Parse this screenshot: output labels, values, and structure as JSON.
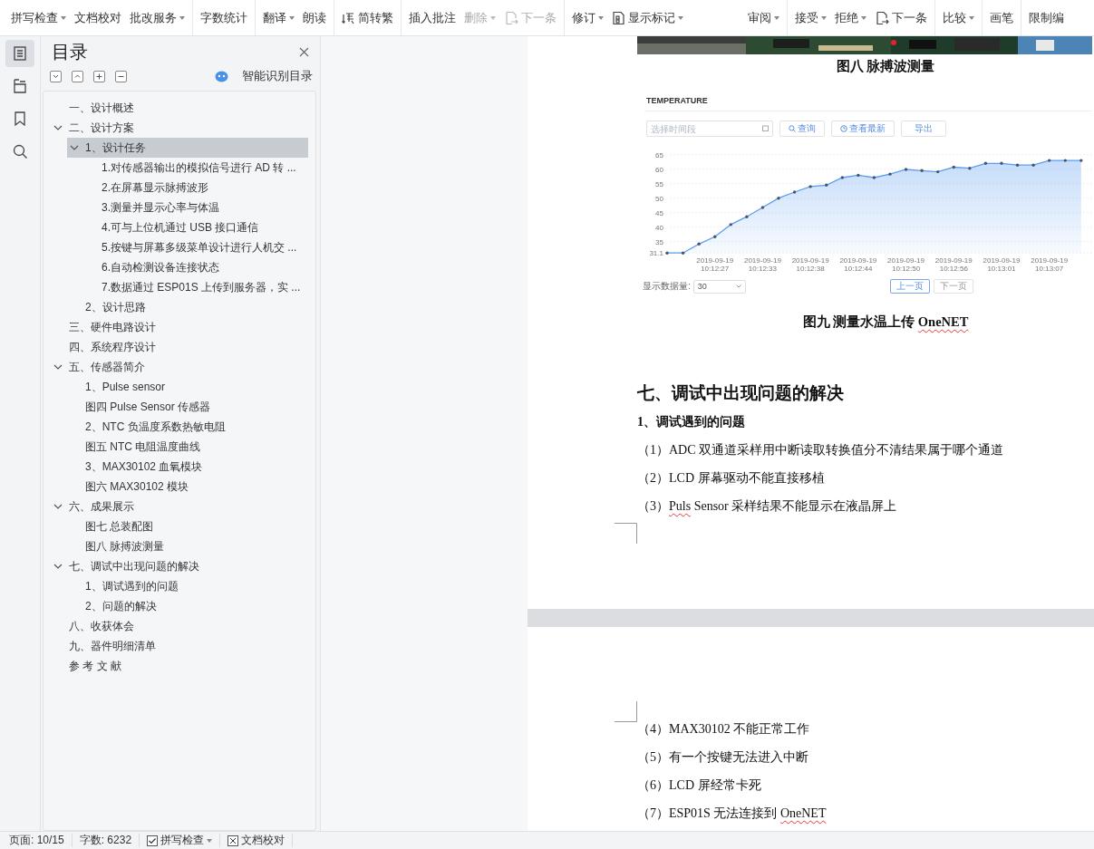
{
  "toolbar": {
    "groups": [
      {
        "items": [
          {
            "label": "拼写检查",
            "kind": "text",
            "caret": true,
            "disabled": false
          },
          {
            "label": "文档校对",
            "kind": "text",
            "caret": false,
            "disabled": false
          },
          {
            "label": "批改服务",
            "kind": "text",
            "caret": true,
            "disabled": false
          }
        ]
      },
      {
        "items": [
          {
            "label": "字数统计",
            "kind": "text",
            "caret": false,
            "disabled": false
          }
        ]
      },
      {
        "items": [
          {
            "label": "翻译",
            "kind": "text",
            "caret": true,
            "disabled": false
          },
          {
            "label": "朗读",
            "kind": "text",
            "caret": false,
            "disabled": false
          }
        ]
      },
      {
        "items": [
          {
            "label": "简转繁",
            "kind": "convert",
            "caret": false,
            "disabled": false
          }
        ]
      },
      {
        "items": [
          {
            "label": "插入批注",
            "kind": "text",
            "caret": false,
            "disabled": false
          },
          {
            "label": "删除",
            "kind": "text",
            "caret": true,
            "disabled": true
          },
          {
            "label": "下一条",
            "kind": "next",
            "caret": false,
            "disabled": true
          }
        ]
      },
      {
        "items": [
          {
            "label": "修订",
            "kind": "text",
            "caret": true,
            "disabled": false
          },
          {
            "label": "显示标记",
            "kind": "markup",
            "caret": true,
            "disabled": false
          },
          {
            "label": "审阅",
            "kind": "text",
            "caret": true,
            "disabled": false
          }
        ]
      },
      {
        "items": [
          {
            "label": "接受",
            "kind": "text",
            "caret": true,
            "disabled": false
          },
          {
            "label": "拒绝",
            "kind": "text",
            "caret": true,
            "disabled": false
          },
          {
            "label": "下一条",
            "kind": "next",
            "caret": false,
            "disabled": false
          }
        ]
      },
      {
        "items": [
          {
            "label": "比较",
            "kind": "text",
            "caret": true,
            "disabled": false
          }
        ]
      },
      {
        "items": [
          {
            "label": "画笔",
            "kind": "text",
            "caret": false,
            "disabled": false
          }
        ]
      },
      {
        "items": [
          {
            "label": "限制编",
            "kind": "text",
            "caret": false,
            "disabled": false
          }
        ]
      }
    ]
  },
  "rail": [
    {
      "kind": "outline",
      "selected": true
    },
    {
      "kind": "navigation",
      "selected": false
    },
    {
      "kind": "bookmark",
      "selected": false
    },
    {
      "kind": "search",
      "selected": false
    }
  ],
  "outline": {
    "title": "目录",
    "smart_detect": "智能识别目录",
    "tree": [
      {
        "label": "一、设计概述",
        "selected": false
      },
      {
        "label": "二、设计方案",
        "selected": false,
        "expanded": true,
        "children": [
          {
            "label": "1、设计任务",
            "selected": true,
            "expanded": true,
            "children": [
              {
                "label": "1.对传感器输出的模拟信号进行 AD 转 ...",
                "selected": false
              },
              {
                "label": "2.在屏幕显示脉搏波形",
                "selected": false
              },
              {
                "label": "3.测量并显示心率与体温",
                "selected": false
              },
              {
                "label": "4.可与上位机通过 USB 接口通信",
                "selected": false
              },
              {
                "label": "5.按键与屏幕多级菜单设计进行人机交 ...",
                "selected": false
              },
              {
                "label": "6.自动检测设备连接状态",
                "selected": false
              },
              {
                "label": "7.数据通过 ESP01S 上传到服务器，实 ...",
                "selected": false
              }
            ]
          },
          {
            "label": "2、设计思路",
            "selected": false
          }
        ]
      },
      {
        "label": "三、硬件电路设计",
        "selected": false
      },
      {
        "label": "四、系统程序设计",
        "selected": false
      },
      {
        "label": "五、传感器简介",
        "selected": false,
        "expanded": true,
        "children": [
          {
            "label": "1、Pulse sensor",
            "selected": false
          },
          {
            "label": "图四  Pulse Sensor 传感器",
            "selected": false
          },
          {
            "label": "2、NTC 负温度系数热敏电阻",
            "selected": false
          },
          {
            "label": "图五  NTC 电阻温度曲线",
            "selected": false
          },
          {
            "label": "3、MAX30102 血氧模块",
            "selected": false
          },
          {
            "label": "图六  MAX30102 模块",
            "selected": false
          }
        ]
      },
      {
        "label": "六、成果展示",
        "selected": false,
        "expanded": true,
        "children": [
          {
            "label": "图七  总装配图",
            "selected": false
          },
          {
            "label": "图八  脉搏波测量",
            "selected": false
          }
        ]
      },
      {
        "label": "七、调试中出现问题的解决",
        "selected": false,
        "expanded": true,
        "children": [
          {
            "label": "1、调试遇到的问题",
            "selected": false
          },
          {
            "label": "2、问题的解决",
            "selected": false
          }
        ]
      },
      {
        "label": "八、收获体会",
        "selected": false
      },
      {
        "label": "九、器件明细清单",
        "selected": false
      },
      {
        "label": "参 考 文 献",
        "selected": false
      }
    ]
  },
  "document": {
    "pages": [
      {
        "blocks": [
          {
            "kind": "picture"
          },
          {
            "kind": "caption",
            "parts": [
              {
                "text": "图八  脉搏波测量",
                "flagged": false
              }
            ]
          },
          {
            "kind": "figure",
            "header": "TEMPERATURE",
            "date_field": {
              "placeholder": "选择时间段"
            },
            "buttons": [
              {
                "kind": "search",
                "label": "查询"
              },
              {
                "kind": "refresh",
                "label": "查看最新"
              },
              {
                "kind": "export",
                "label": "导出"
              }
            ],
            "chart_data": {
              "type": "area",
              "categories": [
                null,
                null,
                null,
                "2019-09-19 10:12:27",
                null,
                null,
                "2019-09-19 10:12:33",
                null,
                null,
                "2019-09-19 10:12:38",
                null,
                null,
                "2019-09-19 10:12:44",
                null,
                null,
                "2019-09-19 10:12:50",
                null,
                null,
                "2019-09-19 10:12:56",
                null,
                null,
                "2019-09-19 10:13:01",
                null,
                null,
                "2019-09-19 10:13:07",
                null,
                null
              ],
              "series": [
                {
                  "color": "#5b9cf0",
                  "values": [
                    31.1,
                    31.1,
                    34.2,
                    36.7,
                    40.9,
                    43.6,
                    46.8,
                    50,
                    52.1,
                    54,
                    54.5,
                    57.1,
                    57.9,
                    57.1,
                    58.3,
                    59.9,
                    59.5,
                    59.1,
                    60.7,
                    60.3,
                    62,
                    62,
                    61.4,
                    61.4,
                    63,
                    63,
                    63
                  ]
                }
              ],
              "ylim": [
                31.1,
                65
              ],
              "yticks": [
                31.1,
                35,
                40,
                45,
                50,
                55,
                60,
                65
              ],
              "grid": true
            },
            "page_size_label": "显示数据量:",
            "page_size": "30",
            "pager": [
              {
                "label": "上一页",
                "selected": true
              },
              {
                "label": "下一页",
                "selected": false
              }
            ]
          },
          {
            "kind": "caption",
            "parts": [
              {
                "text": "图九  测量水温上传 ",
                "flagged": false
              },
              {
                "text": "OneNET",
                "flagged": true
              }
            ]
          },
          {
            "kind": "heading",
            "parts": [
              {
                "text": "七、调试中出现问题的解决",
                "flagged": false
              }
            ]
          },
          {
            "kind": "subheading",
            "parts": [
              {
                "text": "1、调试遇到的问题",
                "flagged": false
              }
            ]
          },
          {
            "kind": "paragraph",
            "parts": [
              {
                "text": "（1）ADC 双通道采样用中断读取转换值分不清结果属于哪个通道",
                "flagged": false
              }
            ]
          },
          {
            "kind": "paragraph",
            "parts": [
              {
                "text": "（2）LCD 屏幕驱动不能直接移植",
                "flagged": false
              }
            ]
          },
          {
            "kind": "paragraph",
            "parts": [
              {
                "text": "（3）",
                "flagged": false
              },
              {
                "text": "Puls",
                "flagged": true
              },
              {
                "text": " Sensor 采样结果不能显示在液晶屏上",
                "flagged": false
              }
            ]
          },
          {
            "kind": "mark-end"
          }
        ]
      },
      {
        "blocks": [
          {
            "kind": "mark-start"
          },
          {
            "kind": "paragraph",
            "parts": [
              {
                "text": "（4）MAX30102 不能正常工作",
                "flagged": false
              }
            ]
          },
          {
            "kind": "paragraph",
            "parts": [
              {
                "text": "（5）有一个按键无法进入中断",
                "flagged": false
              }
            ]
          },
          {
            "kind": "paragraph",
            "parts": [
              {
                "text": "（6）LCD 屏经常卡死",
                "flagged": false
              }
            ]
          },
          {
            "kind": "paragraph",
            "parts": [
              {
                "text": "（7）ESP01S 无法连接到 ",
                "flagged": false
              },
              {
                "text": "OneNET",
                "flagged": true
              }
            ]
          }
        ]
      }
    ]
  },
  "status_bar": {
    "page": "页面: 10/15",
    "words": "字数: 6232",
    "spell_check": {
      "label": "拼写检查",
      "checked": true
    },
    "proofread": {
      "label": "文档校对"
    }
  }
}
